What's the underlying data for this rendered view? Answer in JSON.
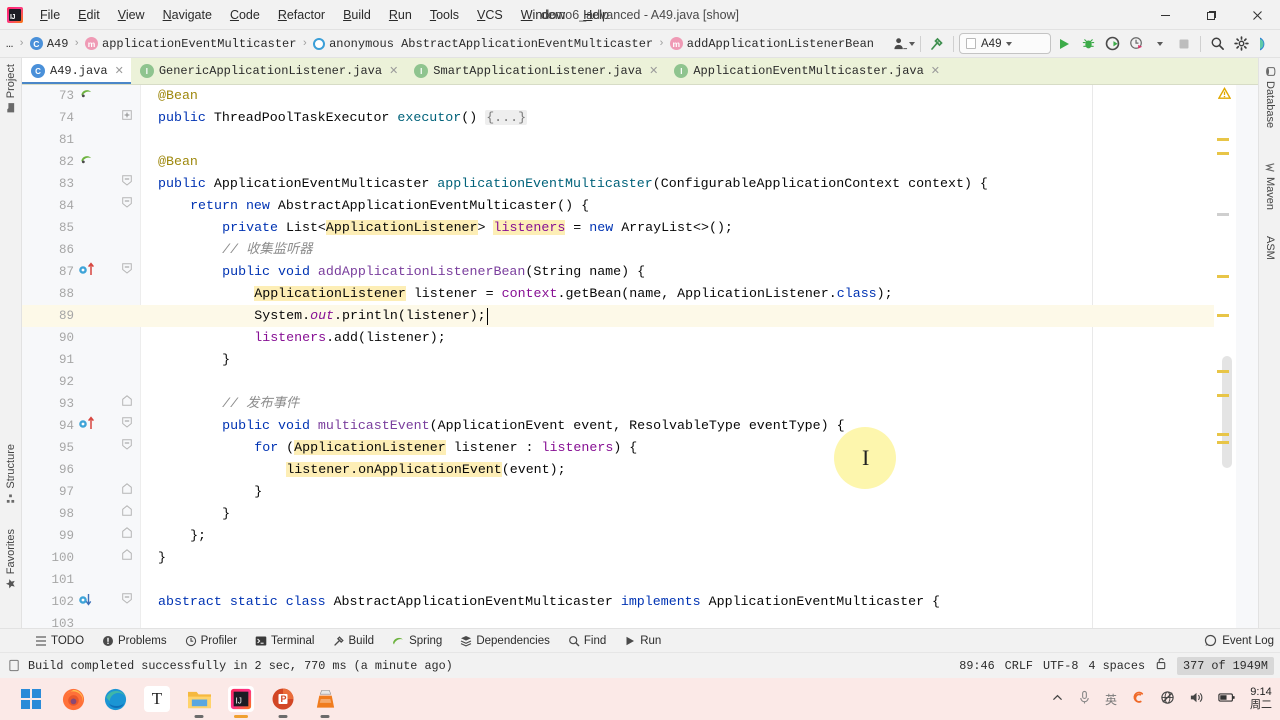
{
  "titlebar": {
    "menus": [
      "File",
      "Edit",
      "View",
      "Navigate",
      "Code",
      "Refactor",
      "Build",
      "Run",
      "Tools",
      "VCS",
      "Window",
      "Help"
    ],
    "window_title": "demo6_advanced - A49.java [show]",
    "minimize": "—",
    "maximize": "❐",
    "close": "✕"
  },
  "navbar": {
    "crumbs": [
      {
        "label": "…",
        "icon": "ellipsis-icon"
      },
      {
        "label": "A49",
        "icon": "class-icon"
      },
      {
        "label": "applicationEventMulticaster",
        "icon": "method-icon"
      },
      {
        "label": "anonymous AbstractApplicationEventMulticaster",
        "icon": "anonymous-class-icon"
      },
      {
        "label": "addApplicationListenerBean",
        "icon": "method-icon"
      }
    ],
    "run_config": "A49",
    "icons": [
      "user-settings-icon",
      "hammer-icon",
      "run-icon",
      "debug-icon",
      "run-coverage-icon",
      "profile-icon",
      "stop-icon",
      "search-icon",
      "settings-icon",
      "ai-assistant-icon"
    ]
  },
  "tabs": [
    {
      "label": "A49.java",
      "icon": "java-class-icon",
      "active": true
    },
    {
      "label": "GenericApplicationListener.java",
      "icon": "java-interface-icon",
      "active": false
    },
    {
      "label": "SmartApplicationListener.java",
      "icon": "java-interface-icon",
      "active": false
    },
    {
      "label": "ApplicationEventMulticaster.java",
      "icon": "java-interface-icon",
      "active": false
    }
  ],
  "left_strip": [
    {
      "label": "Project",
      "icon": "project-folder-icon"
    },
    {
      "label": "Structure",
      "icon": "structure-icon"
    },
    {
      "label": "Favorites",
      "icon": "star-icon"
    }
  ],
  "right_strip": [
    {
      "label": "Database",
      "icon": "database-icon"
    },
    {
      "label": "Maven",
      "icon": "maven-icon"
    },
    {
      "label": "ASM",
      "icon": "asm-icon"
    }
  ],
  "editor": {
    "lines": [
      {
        "num": "73",
        "gutter": "spring-bean-icon",
        "fold": "",
        "highlight": false,
        "indent": 0,
        "segments": [
          {
            "t": "@Bean",
            "c": "ann"
          }
        ]
      },
      {
        "num": "74",
        "gutter": "",
        "fold": "plus",
        "highlight": false,
        "indent": 0,
        "segments": [
          {
            "t": "public ",
            "c": "kw"
          },
          {
            "t": "ThreadPoolTaskExecutor ",
            "c": "ty"
          },
          {
            "t": "executor",
            "c": "fn"
          },
          {
            "t": "() ",
            "c": "ty"
          },
          {
            "t": "{...}",
            "c": "foldph"
          }
        ]
      },
      {
        "num": "81",
        "gutter": "",
        "fold": "",
        "highlight": false,
        "indent": 0,
        "segments": []
      },
      {
        "num": "82",
        "gutter": "spring-bean-icon",
        "fold": "",
        "highlight": false,
        "indent": 0,
        "segments": [
          {
            "t": "@Bean",
            "c": "ann"
          }
        ]
      },
      {
        "num": "83",
        "gutter": "",
        "fold": "down",
        "highlight": false,
        "indent": 0,
        "segments": [
          {
            "t": "public ",
            "c": "kw"
          },
          {
            "t": "ApplicationEventMulticaster ",
            "c": "ty"
          },
          {
            "t": "applicationEventMulticaster",
            "c": "fn"
          },
          {
            "t": "(ConfigurableApplicationContext context) {",
            "c": "ty"
          }
        ]
      },
      {
        "num": "84",
        "gutter": "",
        "fold": "down",
        "highlight": false,
        "indent": 1,
        "segments": [
          {
            "t": "return ",
            "c": "kw"
          },
          {
            "t": "new ",
            "c": "kw"
          },
          {
            "t": "AbstractApplicationEventMulticaster() {",
            "c": "ty"
          }
        ]
      },
      {
        "num": "85",
        "gutter": "",
        "fold": "",
        "highlight": false,
        "indent": 2,
        "segments": [
          {
            "t": "private ",
            "c": "kw"
          },
          {
            "t": "List<",
            "c": "ty"
          },
          {
            "t": "ApplicationListener",
            "c": "hi"
          },
          {
            "t": "> ",
            "c": "ty"
          },
          {
            "t": "listeners",
            "c": "fld hi"
          },
          {
            "t": " = ",
            "c": "ty"
          },
          {
            "t": "new ",
            "c": "kw"
          },
          {
            "t": "ArrayList<>();",
            "c": "ty"
          }
        ]
      },
      {
        "num": "86",
        "gutter": "",
        "fold": "",
        "highlight": false,
        "indent": 2,
        "segments": [
          {
            "t": "// 收集监听器",
            "c": "cm"
          }
        ]
      },
      {
        "num": "87",
        "gutter": "implementing-method-icon",
        "fold": "down",
        "highlight": false,
        "indent": 2,
        "segments": [
          {
            "t": "public ",
            "c": "kw"
          },
          {
            "t": "void ",
            "c": "kw"
          },
          {
            "t": "addApplicationListenerBean",
            "c": "fnd"
          },
          {
            "t": "(String name) {",
            "c": "ty"
          }
        ]
      },
      {
        "num": "88",
        "gutter": "",
        "fold": "",
        "highlight": false,
        "indent": 3,
        "segments": [
          {
            "t": "ApplicationListener",
            "c": "hi"
          },
          {
            "t": " listener = ",
            "c": "ty"
          },
          {
            "t": "context",
            "c": "fld"
          },
          {
            "t": ".getBean(name, ApplicationListener.",
            "c": "ty"
          },
          {
            "t": "class",
            "c": "kw"
          },
          {
            "t": ");",
            "c": "ty"
          }
        ]
      },
      {
        "num": "89",
        "gutter": "",
        "fold": "",
        "highlight": true,
        "indent": 3,
        "segments": [
          {
            "t": "System.",
            "c": "ty"
          },
          {
            "t": "out",
            "c": "stat"
          },
          {
            "t": ".println(listener);",
            "c": "ty"
          }
        ]
      },
      {
        "num": "90",
        "gutter": "",
        "fold": "",
        "highlight": false,
        "indent": 3,
        "segments": [
          {
            "t": "listeners",
            "c": "fld"
          },
          {
            "t": ".add(listener);",
            "c": "ty"
          }
        ]
      },
      {
        "num": "91",
        "gutter": "",
        "fold": "",
        "highlight": false,
        "indent": 2,
        "segments": [
          {
            "t": "}",
            "c": "ty"
          }
        ]
      },
      {
        "num": "92",
        "gutter": "",
        "fold": "",
        "highlight": false,
        "indent": 0,
        "segments": []
      },
      {
        "num": "93",
        "gutter": "",
        "fold": "up",
        "highlight": false,
        "indent": 2,
        "segments": [
          {
            "t": "// 发布事件",
            "c": "cm"
          }
        ]
      },
      {
        "num": "94",
        "gutter": "implementing-method-icon",
        "fold": "down",
        "highlight": false,
        "indent": 2,
        "segments": [
          {
            "t": "public ",
            "c": "kw"
          },
          {
            "t": "void ",
            "c": "kw"
          },
          {
            "t": "multicastEvent",
            "c": "fnd"
          },
          {
            "t": "(ApplicationEvent event, ResolvableType eventType) {",
            "c": "ty"
          }
        ]
      },
      {
        "num": "95",
        "gutter": "",
        "fold": "down",
        "highlight": false,
        "indent": 3,
        "segments": [
          {
            "t": "for ",
            "c": "kw"
          },
          {
            "t": "(",
            "c": "ty"
          },
          {
            "t": "ApplicationListener",
            "c": "hi"
          },
          {
            "t": " listener : ",
            "c": "ty"
          },
          {
            "t": "listeners",
            "c": "fld"
          },
          {
            "t": ") {",
            "c": "ty"
          }
        ]
      },
      {
        "num": "96",
        "gutter": "",
        "fold": "",
        "highlight": false,
        "indent": 4,
        "segments": [
          {
            "t": "listener.onApplicationEvent",
            "c": "hi"
          },
          {
            "t": "(event);",
            "c": "ty"
          }
        ]
      },
      {
        "num": "97",
        "gutter": "",
        "fold": "up",
        "highlight": false,
        "indent": 3,
        "segments": [
          {
            "t": "}",
            "c": "ty"
          }
        ]
      },
      {
        "num": "98",
        "gutter": "",
        "fold": "up",
        "highlight": false,
        "indent": 2,
        "segments": [
          {
            "t": "}",
            "c": "ty"
          }
        ]
      },
      {
        "num": "99",
        "gutter": "",
        "fold": "up",
        "highlight": false,
        "indent": 1,
        "segments": [
          {
            "t": "};",
            "c": "ty"
          }
        ]
      },
      {
        "num": "100",
        "gutter": "",
        "fold": "up",
        "highlight": false,
        "indent": 0,
        "segments": [
          {
            "t": "}",
            "c": "ty"
          }
        ]
      },
      {
        "num": "101",
        "gutter": "",
        "fold": "",
        "highlight": false,
        "indent": 0,
        "segments": []
      },
      {
        "num": "102",
        "gutter": "overridden-method-icon",
        "fold": "down",
        "highlight": false,
        "indent": 0,
        "segments": [
          {
            "t": "abstract ",
            "c": "kw"
          },
          {
            "t": "static ",
            "c": "kw"
          },
          {
            "t": "class ",
            "c": "kw"
          },
          {
            "t": "AbstractApplicationEventMulticaster ",
            "c": "ty"
          },
          {
            "t": "implements ",
            "c": "kw"
          },
          {
            "t": "ApplicationEventMulticaster {",
            "c": "ty"
          }
        ]
      },
      {
        "num": "103",
        "gutter": "",
        "fold": "",
        "highlight": false,
        "indent": 0,
        "segments": []
      }
    ]
  },
  "bottom_bar": {
    "items": [
      {
        "label": "TODO",
        "icon": "todo-icon"
      },
      {
        "label": "Problems",
        "icon": "problems-icon"
      },
      {
        "label": "Profiler",
        "icon": "profiler-icon"
      },
      {
        "label": "Terminal",
        "icon": "terminal-icon"
      },
      {
        "label": "Build",
        "icon": "build-hammer-icon"
      },
      {
        "label": "Spring",
        "icon": "spring-leaf-icon"
      },
      {
        "label": "Dependencies",
        "icon": "dependencies-icon"
      },
      {
        "label": "Find",
        "icon": "find-icon"
      },
      {
        "label": "Run",
        "icon": "run-icon"
      }
    ],
    "event_log": "Event Log"
  },
  "statusbar": {
    "message": "Build completed successfully in 2 sec, 770 ms (a minute ago)",
    "caret_position": "89:46",
    "line_separator": "CRLF",
    "encoding": "UTF-8",
    "indent": "4 spaces",
    "lock": "unlocked-icon",
    "memory": "377 of 1949M"
  },
  "taskbar": {
    "apps": [
      {
        "name": "windows-start-icon",
        "running": false
      },
      {
        "name": "firefox-icon",
        "running": false
      },
      {
        "name": "edge-icon",
        "running": false
      },
      {
        "name": "typora-icon",
        "running": false
      },
      {
        "name": "file-explorer-icon",
        "running": true
      },
      {
        "name": "intellij-idea-icon",
        "running": true,
        "active": true
      },
      {
        "name": "powerpoint-icon",
        "running": true
      },
      {
        "name": "vlc-icon",
        "running": true
      }
    ],
    "tray": [
      "chevron-up-icon",
      "microphone-icon",
      "ime-chinese-icon",
      "sogou-input-icon",
      "network-offline-icon",
      "volume-icon",
      "battery-icon"
    ],
    "time": "9:14",
    "date": "周二"
  },
  "colors": {
    "accent": "#4a86c8",
    "tab_bar": "#ecf2d9",
    "highlight_line": "#fdf9e8",
    "identifier_highlight": "#fdeeb6",
    "keyword": "#0033b3",
    "warning_marker": "#e8c547",
    "taskbar": "#fbe9e7"
  }
}
